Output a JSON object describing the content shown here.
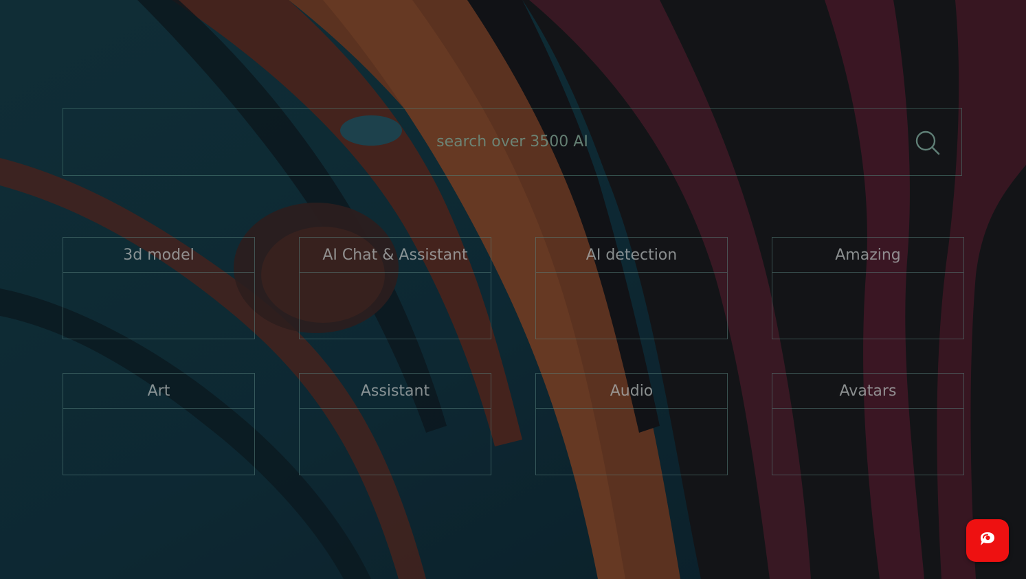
{
  "search": {
    "placeholder": "search over 3500 AI",
    "icon": "search-icon"
  },
  "categories": [
    {
      "label": "3d model"
    },
    {
      "label": "AI Chat & Assistant"
    },
    {
      "label": "AI detection"
    },
    {
      "label": "Amazing"
    },
    {
      "label": "Art"
    },
    {
      "label": "Assistant"
    },
    {
      "label": "Audio"
    },
    {
      "label": "Avatars"
    }
  ],
  "chat_widget": {
    "icon": "chat-bubble-icon",
    "color": "#ee1111"
  },
  "colors": {
    "border": "#4f8278",
    "card_text": "#a9aeae",
    "search_text": "#6e8c7d"
  }
}
